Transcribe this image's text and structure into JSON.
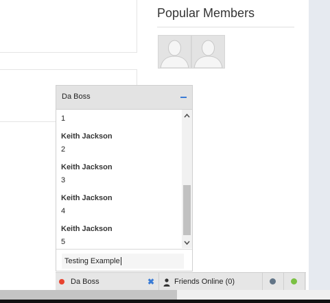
{
  "sidebar": {
    "popular_title": "Popular Members"
  },
  "chat": {
    "header_title": "Da Boss",
    "messages": [
      {
        "text": "1"
      },
      {
        "author": "Keith Jackson",
        "text": "2"
      },
      {
        "author": "Keith Jackson",
        "text": "3"
      },
      {
        "author": "Keith Jackson",
        "text": "4"
      },
      {
        "author": "Keith Jackson",
        "text": "5"
      }
    ],
    "input_value": "Testing Example"
  },
  "chat_bar": {
    "tab_label": "Da Boss",
    "friends_label": "Friends Online (0)"
  },
  "colors": {
    "accent_blue": "#3a7bd5",
    "status_red": "#e8432f",
    "status_gray": "#627587",
    "status_green": "#7bc143"
  },
  "icons": [
    "minimize-icon",
    "close-icon",
    "user-icon",
    "chevron-up-icon",
    "chevron-down-icon",
    "avatar-placeholder-icon"
  ]
}
